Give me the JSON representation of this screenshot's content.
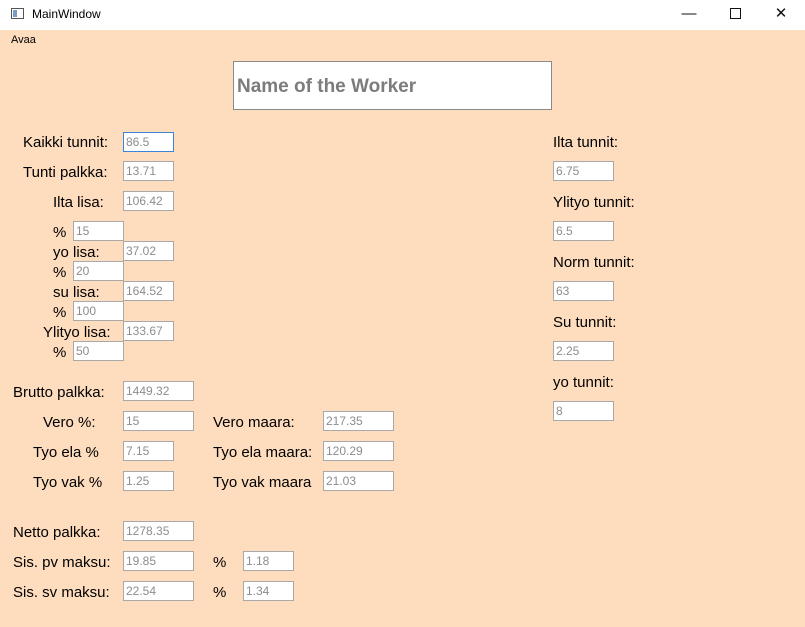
{
  "window": {
    "title": "MainWindow",
    "minimize_glyph": "—",
    "close_glyph": "✕"
  },
  "menu": {
    "open": "Avaa"
  },
  "header": {
    "worker_name_placeholder": "Name of the Worker"
  },
  "left": {
    "kaikki_tunnit": {
      "label": "Kaikki tunnit:",
      "value": "86.5"
    },
    "tunti_palkka": {
      "label": "Tunti palkka:",
      "value": "13.71"
    },
    "ilta_lisa": {
      "label": "Ilta lisa:",
      "value": "106.42",
      "pct_label": "%",
      "pct": "15"
    },
    "yo_lisa": {
      "label": "yo lisa:",
      "value": "37.02",
      "pct_label": "%",
      "pct": "20"
    },
    "su_lisa": {
      "label": "su lisa:",
      "value": "164.52",
      "pct_label": "%",
      "pct": "100"
    },
    "ylityo_lisa": {
      "label": "Ylityo lisa:",
      "value": "133.67",
      "pct_label": "%",
      "pct": "50"
    }
  },
  "salary": {
    "brutto": {
      "label": "Brutto palkka:",
      "value": "1449.32"
    },
    "vero_pct": {
      "label": "Vero %:",
      "value": "15"
    },
    "vero_maara": {
      "label": "Vero maara:",
      "value": "217.35"
    },
    "tyo_ela_pct": {
      "label": "Tyo ela %",
      "value": "7.15"
    },
    "tyo_ela_maara": {
      "label": "Tyo ela maara:",
      "value": "120.29"
    },
    "tyo_vak_pct": {
      "label": "Tyo vak %",
      "value": "1.25"
    },
    "tyo_vak_maara": {
      "label": "Tyo vak maara",
      "value": "21.03"
    },
    "netto": {
      "label": "Netto palkka:",
      "value": "1278.35"
    },
    "sis_pv": {
      "label": "Sis. pv maksu:",
      "value": "19.85",
      "pct_label": "%",
      "pct": "1.18"
    },
    "sis_sv": {
      "label": "Sis. sv maksu:",
      "value": "22.54",
      "pct_label": "%",
      "pct": "1.34"
    }
  },
  "right": {
    "ilta_tunnit": {
      "label": "Ilta tunnit:",
      "value": "6.75"
    },
    "ylityo_tunnit": {
      "label": "Ylityo tunnit:",
      "value": "6.5"
    },
    "norm_tunnit": {
      "label": "Norm tunnit:",
      "value": "63"
    },
    "su_tunnit": {
      "label": "Su tunnit:",
      "value": "2.25"
    },
    "yo_tunnit": {
      "label": "yo tunnit:",
      "value": "8"
    }
  }
}
